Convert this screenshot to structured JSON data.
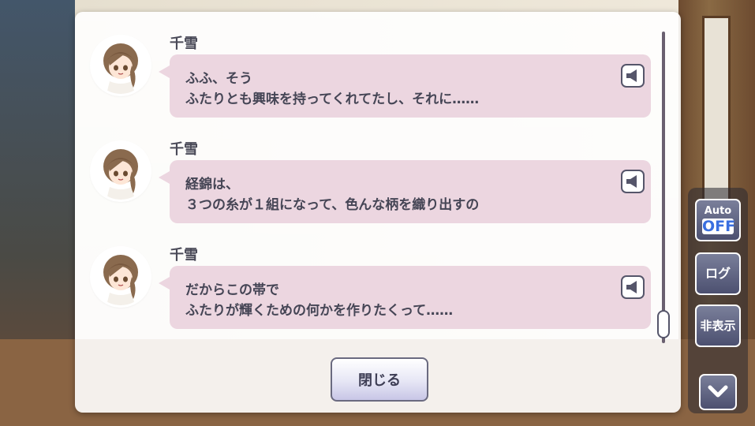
{
  "log": {
    "entries": [
      {
        "speaker": "千雪",
        "line1": "ふふ、そう",
        "line2": "ふたりとも興味を持ってくれてたし、それに……"
      },
      {
        "speaker": "千雪",
        "line1": "経錦は、",
        "line2": "３つの糸が１組になって、色んな柄を織り出すの"
      },
      {
        "speaker": "千雪",
        "line1": "だからこの帯で",
        "line2": "ふたりが輝くための何かを作りたくって……"
      }
    ],
    "close_label": "閉じる"
  },
  "side": {
    "auto_label": "Auto",
    "auto_state": "OFF",
    "log_label": "ログ",
    "hide_label": "非表示"
  },
  "icons": {
    "voice": "speaker-icon",
    "down": "chevron-down-icon"
  },
  "colors": {
    "bubble": "#ecd6e0",
    "text": "#454555",
    "auto_off": "#3a6fe0"
  }
}
